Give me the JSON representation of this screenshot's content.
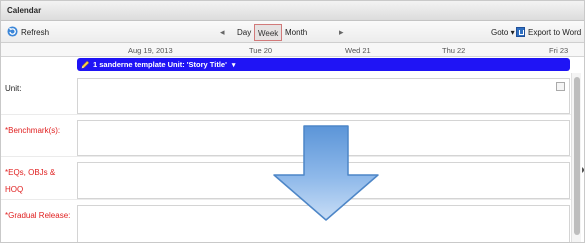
{
  "window": {
    "title": "Calendar"
  },
  "toolbar": {
    "refresh_label": "Refresh",
    "prev_symbol": "◂",
    "next_symbol": "▸",
    "views": {
      "day": "Day",
      "week": "Week",
      "month": "Month"
    },
    "active_view": "Week",
    "goto_label": "Goto ▾",
    "export_label": "Export to Word"
  },
  "dates": {
    "first": "Aug 19, 2013",
    "tue": "Tue 20",
    "wed": "Wed 21",
    "thu": "Thu 22",
    "fri": "Fri 23"
  },
  "event": {
    "label": "1 sanderne template Unit: 'Story Title'",
    "caret": "▾",
    "color": "#1f14f5"
  },
  "rows": [
    {
      "label": "Unit:",
      "color": "#222222"
    },
    {
      "label": "*Benchmark(s):",
      "color": "#e02020"
    },
    {
      "label": "*EQs, OBJs & HOQ",
      "color": "#e02020"
    },
    {
      "label": "*Gradual Release:",
      "color": "#e02020"
    }
  ],
  "icons": {
    "refresh": "refresh-icon",
    "export": "word-document-icon",
    "event": "pencil-icon",
    "overlay": "down-arrow-icon"
  }
}
